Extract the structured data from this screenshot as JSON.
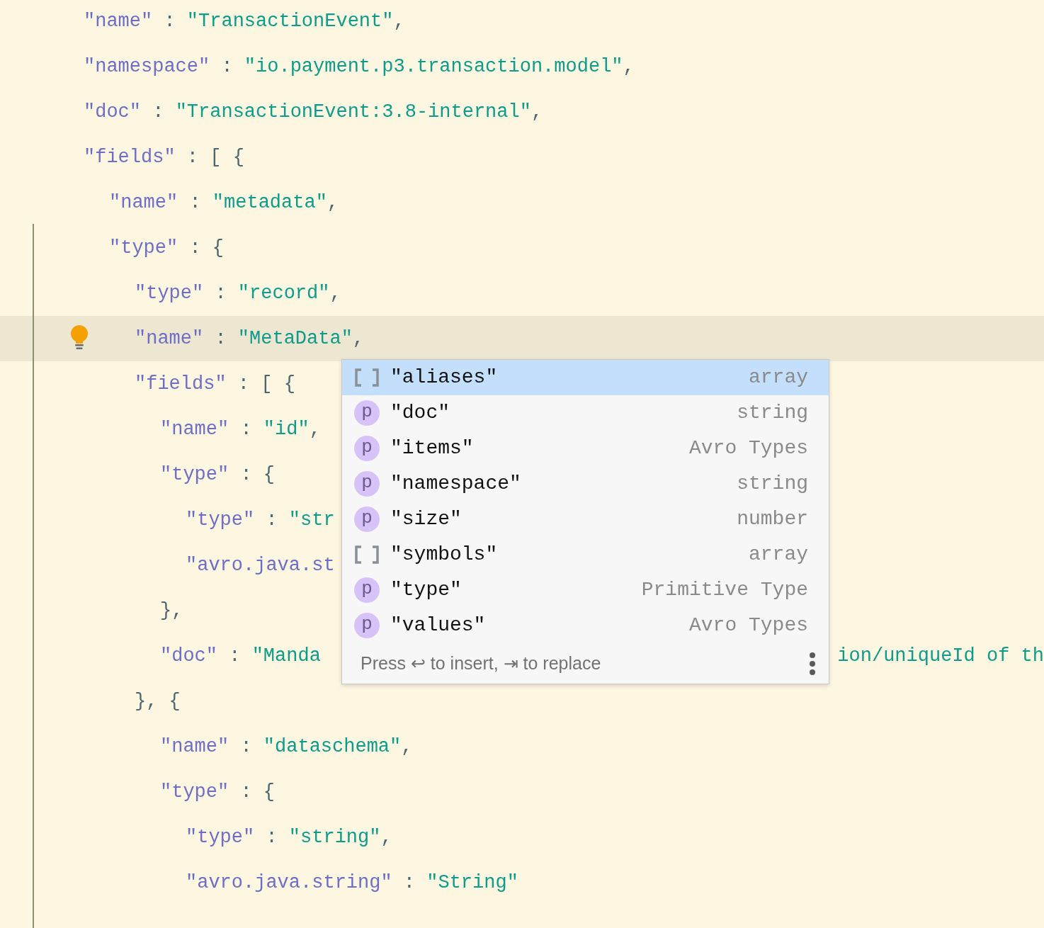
{
  "editor": {
    "lines": [
      {
        "tokens": [
          {
            "kind": "key",
            "text": "\"name\""
          },
          {
            "kind": "punct",
            "text": " : "
          },
          {
            "kind": "string",
            "text": "\"TransactionEvent\""
          },
          {
            "kind": "punct",
            "text": ","
          }
        ]
      },
      {
        "tokens": [
          {
            "kind": "key",
            "text": "\"namespace\""
          },
          {
            "kind": "punct",
            "text": " : "
          },
          {
            "kind": "string",
            "text": "\"io.payment.p3.transaction.model\""
          },
          {
            "kind": "punct",
            "text": ","
          }
        ]
      },
      {
        "tokens": [
          {
            "kind": "key",
            "text": "\"doc\""
          },
          {
            "kind": "punct",
            "text": " : "
          },
          {
            "kind": "string",
            "text": "\"TransactionEvent:3.8-internal\""
          },
          {
            "kind": "punct",
            "text": ","
          }
        ]
      },
      {
        "tokens": [
          {
            "kind": "key",
            "text": "\"fields\""
          },
          {
            "kind": "punct",
            "text": " : [ {"
          }
        ],
        "children": [
          {
            "tokens": [
              {
                "kind": "key",
                "text": "\"name\""
              },
              {
                "kind": "punct",
                "text": " : "
              },
              {
                "kind": "string",
                "text": "\"metadata\""
              },
              {
                "kind": "punct",
                "text": ","
              }
            ]
          },
          {
            "tokens": [
              {
                "kind": "key",
                "text": "\"type\""
              },
              {
                "kind": "punct",
                "text": " : {"
              }
            ],
            "children": [
              {
                "tokens": [
                  {
                    "kind": "key",
                    "text": "\"type\""
                  },
                  {
                    "kind": "punct",
                    "text": " : "
                  },
                  {
                    "kind": "string",
                    "text": "\"record\""
                  },
                  {
                    "kind": "punct",
                    "text": ","
                  }
                ]
              },
              {
                "highlighted": true,
                "intention_bulb": true,
                "tokens": [
                  {
                    "kind": "key",
                    "text": "\"name\""
                  },
                  {
                    "kind": "punct",
                    "text": " : "
                  },
                  {
                    "kind": "string",
                    "text": "\"MetaData\""
                  },
                  {
                    "kind": "punct",
                    "text": ","
                  }
                ]
              },
              {
                "tokens": [
                  {
                    "kind": "key",
                    "text": "\"fields\""
                  },
                  {
                    "kind": "punct",
                    "text": " : [ {"
                  }
                ],
                "children": [
                  {
                    "tokens": [
                      {
                        "kind": "key",
                        "text": "\"name\""
                      },
                      {
                        "kind": "punct",
                        "text": " : "
                      },
                      {
                        "kind": "string",
                        "text": "\"id\""
                      },
                      {
                        "kind": "punct",
                        "text": ","
                      }
                    ]
                  },
                  {
                    "tokens": [
                      {
                        "kind": "key",
                        "text": "\"type\""
                      },
                      {
                        "kind": "punct",
                        "text": " : {"
                      }
                    ],
                    "children": [
                      {
                        "tokens": [
                          {
                            "kind": "key",
                            "text": "\"type\""
                          },
                          {
                            "kind": "punct",
                            "text": " : "
                          },
                          {
                            "kind": "string",
                            "text": "\"str"
                          }
                        ]
                      },
                      {
                        "tokens": [
                          {
                            "kind": "key",
                            "text": "\"avro.java.st"
                          }
                        ]
                      }
                    ]
                  },
                  {
                    "tokens": [
                      {
                        "kind": "punct",
                        "text": "},"
                      }
                    ]
                  },
                  {
                    "tokens": [
                      {
                        "kind": "key",
                        "text": "\"doc\""
                      },
                      {
                        "kind": "punct",
                        "text": " : "
                      },
                      {
                        "kind": "string",
                        "text": "\"Manda"
                      },
                      {
                        "kind": "string",
                        "text": "ion/uniqueId of th",
                        "beyond_popup": true
                      }
                    ]
                  }
                ]
              },
              {
                "tokens": [
                  {
                    "kind": "punct",
                    "text": "}, {"
                  }
                ],
                "children": [
                  {
                    "tokens": [
                      {
                        "kind": "key",
                        "text": "\"name\""
                      },
                      {
                        "kind": "punct",
                        "text": " : "
                      },
                      {
                        "kind": "string",
                        "text": "\"dataschema\""
                      },
                      {
                        "kind": "punct",
                        "text": ","
                      }
                    ]
                  },
                  {
                    "tokens": [
                      {
                        "kind": "key",
                        "text": "\"type\""
                      },
                      {
                        "kind": "punct",
                        "text": " : {"
                      }
                    ],
                    "children": [
                      {
                        "tokens": [
                          {
                            "kind": "key",
                            "text": "\"type\""
                          },
                          {
                            "kind": "punct",
                            "text": " : "
                          },
                          {
                            "kind": "string",
                            "text": "\"string\""
                          },
                          {
                            "kind": "punct",
                            "text": ","
                          }
                        ]
                      },
                      {
                        "tokens": [
                          {
                            "kind": "key",
                            "text": "\"avro.java.string\""
                          },
                          {
                            "kind": "punct",
                            "text": " : "
                          },
                          {
                            "kind": "string",
                            "text": "\"String\""
                          }
                        ]
                      }
                    ]
                  }
                ]
              }
            ]
          }
        ]
      }
    ]
  },
  "completion_popup": {
    "items": [
      {
        "kind": "array",
        "label": "\"aliases\"",
        "detail": "array",
        "selected": true
      },
      {
        "kind": "property",
        "badge": "p",
        "label": "\"doc\"",
        "detail": "string",
        "selected": false
      },
      {
        "kind": "property",
        "badge": "p",
        "label": "\"items\"",
        "detail": "Avro Types",
        "selected": false
      },
      {
        "kind": "property",
        "badge": "p",
        "label": "\"namespace\"",
        "detail": "string",
        "selected": false
      },
      {
        "kind": "property",
        "badge": "p",
        "label": "\"size\"",
        "detail": "number",
        "selected": false
      },
      {
        "kind": "array",
        "label": "\"symbols\"",
        "detail": "array",
        "selected": false
      },
      {
        "kind": "property",
        "badge": "p",
        "label": "\"type\"",
        "detail": "Primitive Type",
        "selected": false
      },
      {
        "kind": "property",
        "badge": "p",
        "label": "\"values\"",
        "detail": "Avro Types",
        "selected": false
      }
    ],
    "hint": "Press ↩ to insert, ⇥ to replace"
  }
}
